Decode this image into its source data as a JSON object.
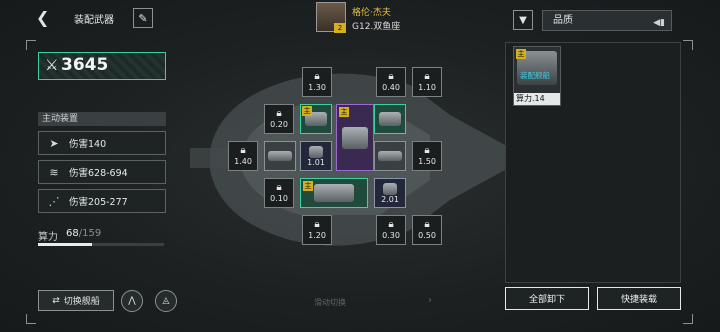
{
  "header": {
    "back_icon": "back-arrow-icon",
    "title": "装配武器",
    "edit_icon": "pencil-icon"
  },
  "pilot": {
    "name": "格伦·杰夫",
    "subtitle": "G12.双鱼座",
    "level": "2"
  },
  "filter": {
    "icon": "filter-icon",
    "sort_label": "品质",
    "sort_icon": "sort-order-icon"
  },
  "left_panel": {
    "power_value": "3645",
    "active_header": "主动装置",
    "stats": [
      {
        "icon": "ship-icon",
        "text": "伤害140"
      },
      {
        "icon": "missile-icon",
        "text": "伤害628-694"
      },
      {
        "icon": "laser-icon",
        "text": "伤害205-277"
      }
    ],
    "compute_label": "算力",
    "compute_used": "68",
    "compute_max": "/159",
    "compute_fraction": 0.428
  },
  "slots": {
    "locked": [
      "1.30",
      "0.40",
      "1.10",
      "0.20",
      "1.40",
      "1.50",
      "0.10",
      "1.20",
      "0.30",
      "0.50"
    ],
    "equipped": [
      "1.01",
      "2.01"
    ],
    "main_tag": "主"
  },
  "bottom": {
    "switch_ship_label": "切换舰船",
    "slide_hint": "滑动切换"
  },
  "inventory": {
    "items": [
      {
        "tag": "主",
        "badge": "装配舰船",
        "footer": "算力.14"
      }
    ]
  },
  "actions": {
    "unload_all": "全部卸下",
    "quick_equip": "快捷装载"
  }
}
